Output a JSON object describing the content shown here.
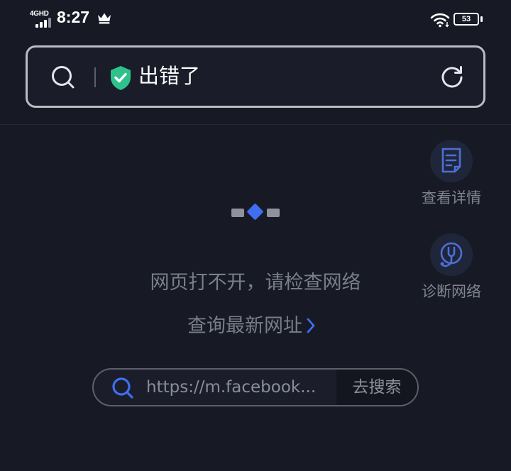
{
  "status_bar": {
    "network": "4GHD",
    "time": "8:27",
    "battery": "53",
    "icons": [
      "signal-icon",
      "crown-icon",
      "wifi-icon",
      "battery-icon"
    ]
  },
  "address_bar": {
    "text": "出错了",
    "icons": [
      "search-icon",
      "shield-check-icon",
      "refresh-icon"
    ],
    "shield_color": "#2ec28a"
  },
  "side_actions": [
    {
      "label": "查看详情",
      "icon": "document-icon"
    },
    {
      "label": "诊断网络",
      "icon": "stethoscope-icon"
    }
  ],
  "error": {
    "message": "网页打不开，请检查网络",
    "link_label": "查询最新网址",
    "link_icon": "chevron-right-icon"
  },
  "search": {
    "value": "https://m.facebook...",
    "button_label": "去搜索",
    "icon": "search-icon"
  },
  "colors": {
    "background": "#171a25",
    "accent": "#3f6ff0",
    "text_muted": "#7a7e8a"
  }
}
